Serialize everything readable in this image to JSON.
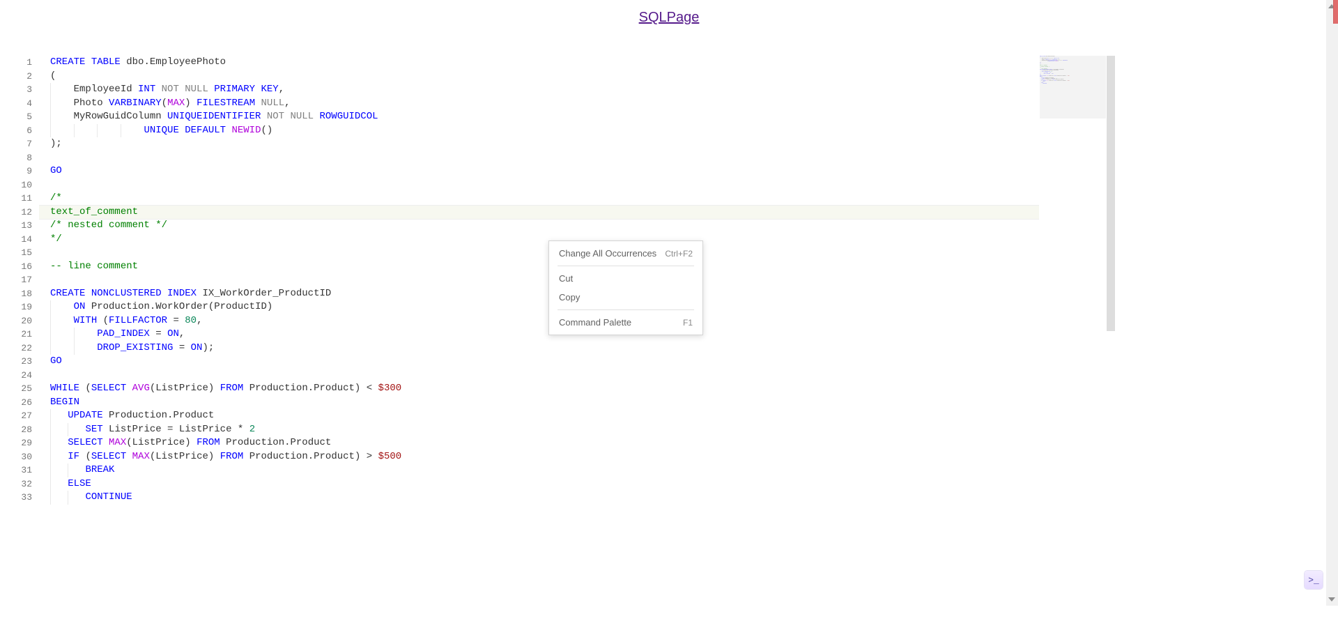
{
  "header": {
    "link_text": "SQLPage"
  },
  "editor": {
    "current_line": 12,
    "first_visible_line": 1,
    "line_numbers": [
      1,
      2,
      3,
      4,
      5,
      6,
      7,
      8,
      9,
      10,
      11,
      12,
      13,
      14,
      15,
      16,
      17,
      18,
      19,
      20,
      21,
      22,
      23,
      24,
      25,
      26,
      27,
      28,
      29,
      30,
      31,
      32,
      33
    ],
    "lines": [
      [
        {
          "t": "CREATE ",
          "c": "kw"
        },
        {
          "t": "TABLE ",
          "c": "kw"
        },
        {
          "t": "dbo.EmployeePhoto",
          "c": ""
        }
      ],
      [
        {
          "t": "(",
          "c": ""
        }
      ],
      [
        {
          "t": "    ",
          "c": "indent-guide"
        },
        {
          "t": "EmployeeId ",
          "c": ""
        },
        {
          "t": "INT ",
          "c": "ty"
        },
        {
          "t": "NOT NULL ",
          "c": "gray"
        },
        {
          "t": "PRIMARY KEY",
          "c": "kw"
        },
        {
          "t": ",",
          "c": ""
        }
      ],
      [
        {
          "t": "    ",
          "c": "indent-guide"
        },
        {
          "t": "Photo ",
          "c": ""
        },
        {
          "t": "VARBINARY",
          "c": "ty"
        },
        {
          "t": "(",
          "c": ""
        },
        {
          "t": "MAX",
          "c": "kw2"
        },
        {
          "t": ") ",
          "c": ""
        },
        {
          "t": "FILESTREAM ",
          "c": "kw"
        },
        {
          "t": "NULL",
          "c": "gray"
        },
        {
          "t": ",",
          "c": ""
        }
      ],
      [
        {
          "t": "    ",
          "c": "indent-guide"
        },
        {
          "t": "MyRowGuidColumn ",
          "c": ""
        },
        {
          "t": "UNIQUEIDENTIFIER ",
          "c": "ty"
        },
        {
          "t": "NOT NULL ",
          "c": "gray"
        },
        {
          "t": "ROWGUIDCOL",
          "c": "kw"
        }
      ],
      [
        {
          "t": "    ",
          "c": "indent-guide"
        },
        {
          "t": "    ",
          "c": "indent-guide"
        },
        {
          "t": "    ",
          "c": "indent-guide"
        },
        {
          "t": "    ",
          "c": "indent-guide"
        },
        {
          "t": "UNIQUE ",
          "c": "kw"
        },
        {
          "t": "DEFAULT ",
          "c": "kw"
        },
        {
          "t": "NEWID",
          "c": "kw2"
        },
        {
          "t": "()",
          "c": ""
        }
      ],
      [
        {
          "t": ");",
          "c": ""
        }
      ],
      [
        {
          "t": "",
          "c": ""
        }
      ],
      [
        {
          "t": "GO",
          "c": "kw"
        }
      ],
      [
        {
          "t": "",
          "c": ""
        }
      ],
      [
        {
          "t": "/*",
          "c": "cm"
        }
      ],
      [
        {
          "t": "text_of_comment",
          "c": "cm"
        }
      ],
      [
        {
          "t": "/* nested comment */",
          "c": "cm"
        }
      ],
      [
        {
          "t": "*/",
          "c": "cm"
        }
      ],
      [
        {
          "t": "",
          "c": ""
        }
      ],
      [
        {
          "t": "-- line comment",
          "c": "cm"
        }
      ],
      [
        {
          "t": "",
          "c": ""
        }
      ],
      [
        {
          "t": "CREATE ",
          "c": "kw"
        },
        {
          "t": "NONCLUSTERED ",
          "c": "kw"
        },
        {
          "t": "INDEX ",
          "c": "kw"
        },
        {
          "t": "IX_WorkOrder_ProductID",
          "c": ""
        }
      ],
      [
        {
          "t": "    ",
          "c": "indent-guide"
        },
        {
          "t": "ON ",
          "c": "kw"
        },
        {
          "t": "Production.WorkOrder(ProductID)",
          "c": ""
        }
      ],
      [
        {
          "t": "    ",
          "c": "indent-guide"
        },
        {
          "t": "WITH ",
          "c": "kw"
        },
        {
          "t": "(",
          "c": ""
        },
        {
          "t": "FILLFACTOR",
          "c": "kw"
        },
        {
          "t": " = ",
          "c": ""
        },
        {
          "t": "80",
          "c": "num"
        },
        {
          "t": ",",
          "c": ""
        }
      ],
      [
        {
          "t": "    ",
          "c": "indent-guide"
        },
        {
          "t": "    ",
          "c": "indent-guide"
        },
        {
          "t": "PAD_INDEX",
          "c": "kw"
        },
        {
          "t": " = ",
          "c": ""
        },
        {
          "t": "ON",
          "c": "kw"
        },
        {
          "t": ",",
          "c": ""
        }
      ],
      [
        {
          "t": "    ",
          "c": "indent-guide"
        },
        {
          "t": "    ",
          "c": "indent-guide"
        },
        {
          "t": "DROP_EXISTING",
          "c": "kw"
        },
        {
          "t": " = ",
          "c": ""
        },
        {
          "t": "ON",
          "c": "kw"
        },
        {
          "t": ");",
          "c": ""
        }
      ],
      [
        {
          "t": "GO",
          "c": "kw"
        }
      ],
      [
        {
          "t": "",
          "c": ""
        }
      ],
      [
        {
          "t": "WHILE ",
          "c": "kw"
        },
        {
          "t": "(",
          "c": ""
        },
        {
          "t": "SELECT ",
          "c": "kw"
        },
        {
          "t": "AVG",
          "c": "kw2"
        },
        {
          "t": "(ListPrice) ",
          "c": ""
        },
        {
          "t": "FROM ",
          "c": "kw"
        },
        {
          "t": "Production.Product) < ",
          "c": ""
        },
        {
          "t": "$300",
          "c": "money"
        }
      ],
      [
        {
          "t": "BEGIN",
          "c": "kw"
        }
      ],
      [
        {
          "t": "   ",
          "c": "indent-guide"
        },
        {
          "t": "UPDATE ",
          "c": "kw"
        },
        {
          "t": "Production.Product",
          "c": ""
        }
      ],
      [
        {
          "t": "   ",
          "c": "indent-guide"
        },
        {
          "t": "   ",
          "c": "indent-guide"
        },
        {
          "t": "SET ",
          "c": "kw"
        },
        {
          "t": "ListPrice = ListPrice * ",
          "c": ""
        },
        {
          "t": "2",
          "c": "num"
        }
      ],
      [
        {
          "t": "   ",
          "c": "indent-guide"
        },
        {
          "t": "SELECT ",
          "c": "kw"
        },
        {
          "t": "MAX",
          "c": "kw2"
        },
        {
          "t": "(ListPrice) ",
          "c": ""
        },
        {
          "t": "FROM ",
          "c": "kw"
        },
        {
          "t": "Production.Product",
          "c": ""
        }
      ],
      [
        {
          "t": "   ",
          "c": "indent-guide"
        },
        {
          "t": "IF ",
          "c": "kw"
        },
        {
          "t": "(",
          "c": ""
        },
        {
          "t": "SELECT ",
          "c": "kw"
        },
        {
          "t": "MAX",
          "c": "kw2"
        },
        {
          "t": "(ListPrice) ",
          "c": ""
        },
        {
          "t": "FROM ",
          "c": "kw"
        },
        {
          "t": "Production.Product) > ",
          "c": ""
        },
        {
          "t": "$500",
          "c": "money"
        }
      ],
      [
        {
          "t": "   ",
          "c": "indent-guide"
        },
        {
          "t": "   ",
          "c": "indent-guide"
        },
        {
          "t": "BREAK",
          "c": "kw"
        }
      ],
      [
        {
          "t": "   ",
          "c": "indent-guide"
        },
        {
          "t": "ELSE",
          "c": "kw"
        }
      ],
      [
        {
          "t": "   ",
          "c": "indent-guide"
        },
        {
          "t": "   ",
          "c": "indent-guide"
        },
        {
          "t": "CONTINUE",
          "c": "kw"
        }
      ]
    ]
  },
  "context_menu": {
    "items": [
      {
        "label": "Change All Occurrences",
        "shortcut": "Ctrl+F2"
      },
      {
        "sep": true
      },
      {
        "label": "Cut",
        "shortcut": ""
      },
      {
        "label": "Copy",
        "shortcut": ""
      },
      {
        "sep": true
      },
      {
        "label": "Command Palette",
        "shortcut": "F1"
      }
    ]
  },
  "terminal_button": {
    "glyph": ">_"
  }
}
